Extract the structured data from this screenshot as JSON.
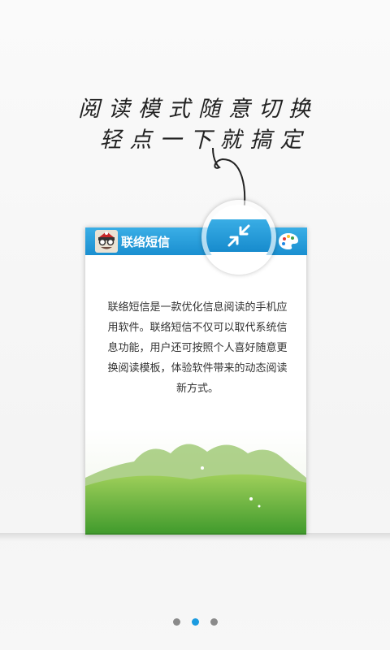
{
  "handwritten": {
    "line1": "阅读模式随意切换",
    "line2": "轻点一下就搞定"
  },
  "card": {
    "title": "联络短信",
    "description": "联络短信是一款优化信息阅读的手机应用软件。联络短信不仅可以取代系统信息功能，用户还可按照个人喜好随意更换阅读模板，体验软件带来的动态阅读新方式。"
  },
  "icons": {
    "avatar": "cartoon-face-icon",
    "mode_switch": "collapse-arrows-icon",
    "theme": "palette-icon"
  },
  "pager": {
    "total": 3,
    "active_index": 1
  },
  "colors": {
    "accent": "#1b9be0",
    "header_blue": "#1a8fd0",
    "dot_inactive": "#8a8a8a"
  }
}
